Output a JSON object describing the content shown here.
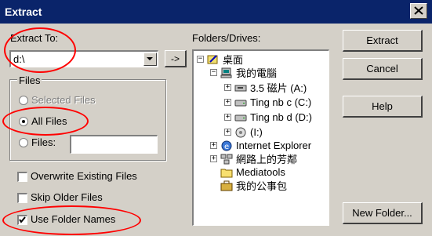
{
  "window": {
    "title": "Extract"
  },
  "extract_to": {
    "label": "Extract To:",
    "value": "d:\\"
  },
  "files_group": {
    "label": "Files",
    "selected_files": "Selected Files",
    "all_files": "All Files",
    "files": "Files:",
    "files_value": ""
  },
  "options": {
    "overwrite": "Overwrite Existing Files",
    "skip_older": "Skip Older Files",
    "use_folder_names": "Use Folder Names"
  },
  "folders": {
    "label": "Folders/Drives:",
    "items": [
      {
        "label": "桌面"
      },
      {
        "label": "我的電腦"
      },
      {
        "label": "3.5 磁片 (A:)"
      },
      {
        "label": "Ting nb c (C:)"
      },
      {
        "label": "Ting nb d (D:)"
      },
      {
        "label": "(I:)"
      },
      {
        "label": "Internet Explorer"
      },
      {
        "label": "網路上的芳鄰"
      },
      {
        "label": "Mediatools"
      },
      {
        "label": "我的公事包"
      }
    ]
  },
  "buttons": {
    "arrow": "->",
    "extract": "Extract",
    "cancel": "Cancel",
    "help": "Help",
    "new_folder": "New Folder..."
  },
  "state": {
    "files_selection": "all_files",
    "overwrite_checked": false,
    "skip_older_checked": false,
    "use_folder_names_checked": true
  },
  "colors": {
    "titlebar": "#0a246a",
    "dialog": "#d4d0c8",
    "highlight_oval": "#ff0000"
  }
}
